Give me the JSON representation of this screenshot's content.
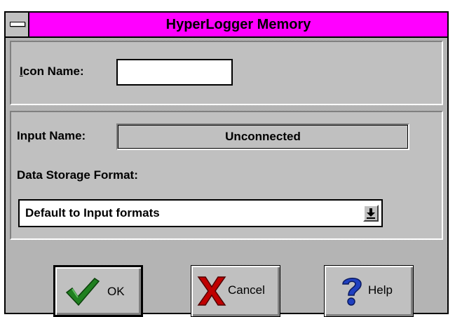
{
  "window": {
    "title": "HyperLogger Memory"
  },
  "form": {
    "icon_name_label_mnemonic": "I",
    "icon_name_label_rest": "con Name:",
    "icon_name_value": "",
    "input_name_label": "Input Name:",
    "input_name_value": "Unconnected",
    "storage_format_label": "Data Storage Format:",
    "storage_format_selected": "Default to Input formats"
  },
  "buttons": {
    "ok_label": "OK",
    "cancel_label": "Cancel",
    "help_label": "Help"
  },
  "icons": {
    "system_menu": "system-menu-icon",
    "dropdown": "dropdown-arrow-icon",
    "ok": "checkmark-icon",
    "cancel": "x-cross-icon",
    "help": "question-mark-icon"
  },
  "colors": {
    "title_bar": "#ff00ff",
    "face": "#c0c0c0",
    "ok_icon": "#208020",
    "cancel_icon": "#c00000",
    "help_icon": "#2040c0"
  }
}
